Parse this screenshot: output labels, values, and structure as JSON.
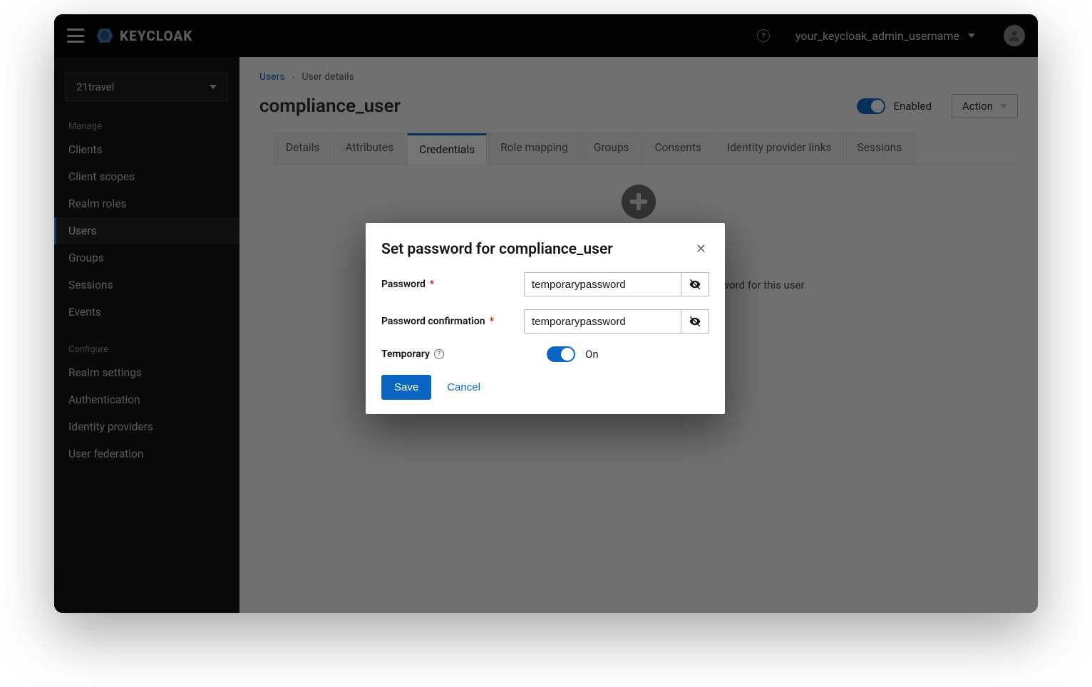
{
  "brand": {
    "name": "KEYCLOAK"
  },
  "header": {
    "username": "your_keycloak_admin_username"
  },
  "sidebar": {
    "realm": "21travel",
    "section_manage": "Manage",
    "section_configure": "Configure",
    "manage_items": [
      {
        "label": "Clients"
      },
      {
        "label": "Client scopes"
      },
      {
        "label": "Realm roles"
      },
      {
        "label": "Users",
        "active": true
      },
      {
        "label": "Groups"
      },
      {
        "label": "Sessions"
      },
      {
        "label": "Events"
      }
    ],
    "configure_items": [
      {
        "label": "Realm settings"
      },
      {
        "label": "Authentication"
      },
      {
        "label": "Identity providers"
      },
      {
        "label": "User federation"
      }
    ]
  },
  "breadcrumb": {
    "parent": "Users",
    "current": "User details"
  },
  "page": {
    "title": "compliance_user",
    "enabled_label": "Enabled",
    "action_label": "Action"
  },
  "tabs": [
    {
      "label": "Details"
    },
    {
      "label": "Attributes"
    },
    {
      "label": "Credentials",
      "active": true
    },
    {
      "label": "Role mapping"
    },
    {
      "label": "Groups"
    },
    {
      "label": "Consents"
    },
    {
      "label": "Identity provider links"
    },
    {
      "label": "Sessions"
    }
  ],
  "empty": {
    "text_suffix": "sword for this user."
  },
  "modal": {
    "title": "Set password for compliance_user",
    "password_label": "Password",
    "password_value": "temporarypassword",
    "password_confirm_label": "Password confirmation",
    "password_confirm_value": "temporarypassword",
    "temporary_label": "Temporary",
    "temporary_state": "On",
    "save": "Save",
    "cancel": "Cancel"
  }
}
